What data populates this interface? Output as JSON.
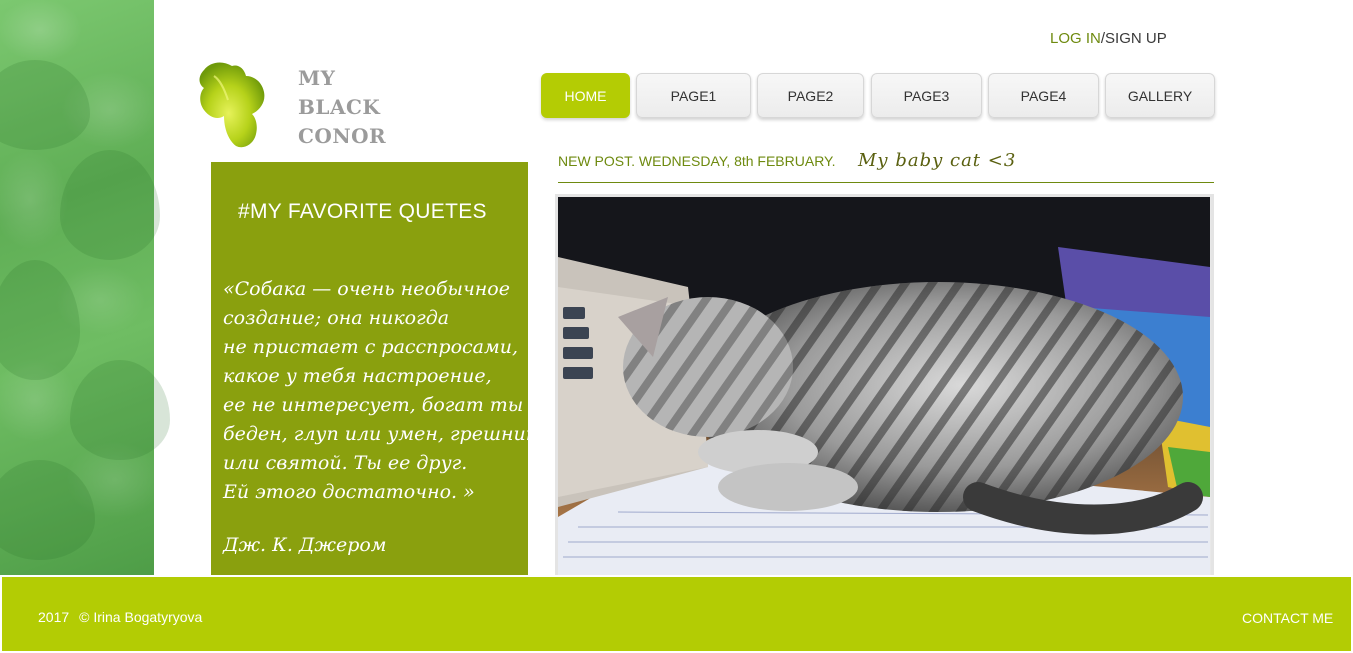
{
  "site": {
    "logo_lines": [
      "MY",
      "BLACK",
      "CONOR"
    ]
  },
  "auth": {
    "login": "LOG IN",
    "separator": "/",
    "signup": "SIGN UP"
  },
  "nav": {
    "items": [
      {
        "label": "HOME",
        "active": true
      },
      {
        "label": "PAGE1",
        "active": false
      },
      {
        "label": "PAGE2",
        "active": false
      },
      {
        "label": "PAGE3",
        "active": false
      },
      {
        "label": "PAGE4",
        "active": false
      },
      {
        "label": "GALLERY",
        "active": false
      }
    ]
  },
  "quotes": {
    "title": "#MY FAVORITE QUETES",
    "lines": [
      "«Собака — очень необычное",
      "создание; она никогда",
      "не пристает с расспросами,",
      "какое у тебя настроение,",
      "ее не интересует, богат ты или",
      "беден, глуп или умен, грешник",
      "или святой. Ты ее друг.",
      "Ей этого достаточно. »"
    ],
    "author": "Дж. К. Джером"
  },
  "post": {
    "meta": "NEW POST. WEDNESDAY, 8th FEBRUARY.",
    "title": "My baby cat <3"
  },
  "footer": {
    "year": "2017",
    "copyright": "© Irina Bogatyryova",
    "contact": "CONTACT ME"
  },
  "colors": {
    "accent": "#b3cc04",
    "panel": "#8aa00e",
    "text_green": "#6e8a0f"
  }
}
